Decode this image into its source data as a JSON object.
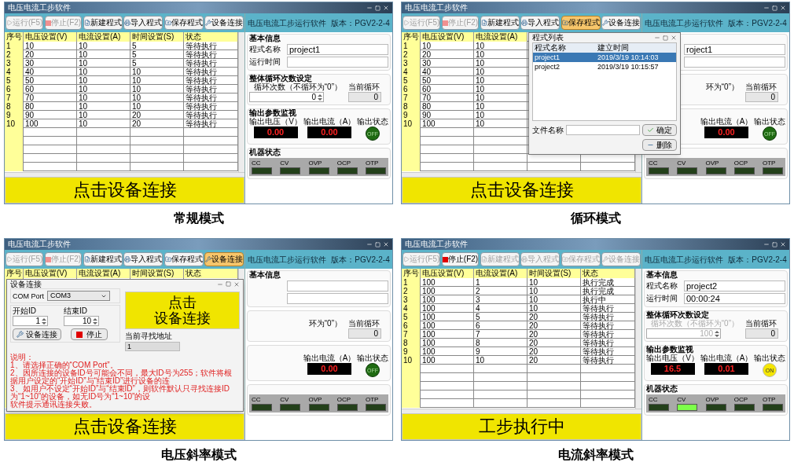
{
  "screens": [
    {
      "title": "电压电流工步软件",
      "caption": "常规模式",
      "toolbar": [
        {
          "kind": "run",
          "label": "运行(F5)",
          "disabled": true,
          "highlighted": false
        },
        {
          "kind": "stop",
          "label": "停止(F2)",
          "disabled": true,
          "highlighted": false
        },
        {
          "kind": "new",
          "label": "新建程式",
          "disabled": false,
          "highlighted": false
        },
        {
          "kind": "import",
          "label": "导入程式",
          "disabled": false,
          "highlighted": false
        },
        {
          "kind": "save",
          "label": "保存程式",
          "disabled": false,
          "highlighted": false
        },
        {
          "kind": "connect",
          "label": "设备连接",
          "disabled": false,
          "highlighted": false
        }
      ],
      "columns": [
        "序号",
        "电压设置(V)",
        "电流设置(A)",
        "时间设置(S)",
        "状态"
      ],
      "rows": [
        [
          "1",
          "10",
          "10",
          "5",
          "等待执行"
        ],
        [
          "2",
          "20",
          "10",
          "5",
          "等待执行"
        ],
        [
          "3",
          "30",
          "10",
          "5",
          "等待执行"
        ],
        [
          "4",
          "40",
          "10",
          "10",
          "等待执行"
        ],
        [
          "5",
          "50",
          "10",
          "10",
          "等待执行"
        ],
        [
          "6",
          "60",
          "10",
          "10",
          "等待执行"
        ],
        [
          "7",
          "70",
          "10",
          "10",
          "等待执行"
        ],
        [
          "8",
          "80",
          "10",
          "10",
          "等待执行"
        ],
        [
          "9",
          "90",
          "10",
          "20",
          "等待执行"
        ],
        [
          "10",
          "100",
          "10",
          "20",
          "等待执行"
        ]
      ],
      "banner": "点击设备连接",
      "panel": {
        "header": "电压电流工步运行软件",
        "version": "版本：PGV2-2-4",
        "basic": {
          "title": "基本信息",
          "name_label": "程式名称",
          "name": "project1",
          "time_label": "运行时间"
        },
        "loop": {
          "title": "整体循环次数设定",
          "count_label": "循环次数（不循环为“0”）",
          "count": "0",
          "disabled": false,
          "current_label": "当前循环",
          "current": "0"
        },
        "output": {
          "title": "输出参数监视",
          "voltage_label": "输出电压（V）",
          "voltage": "0.00",
          "current_label": "输出电流（A）",
          "current": "0.00",
          "state_label": "输出状态",
          "state": "OFF",
          "on": false
        },
        "machine": {
          "title": "机器状态",
          "leds": [
            {
              "label": "CC",
              "on": false
            },
            {
              "label": "CV",
              "on": false
            },
            {
              "label": "OVP",
              "on": false
            },
            {
              "label": "OCP",
              "on": false
            },
            {
              "label": "OTP",
              "on": false
            }
          ]
        }
      }
    },
    {
      "title": "电压电流工步软件",
      "caption": "循环模式",
      "toolbar": [
        {
          "kind": "run",
          "label": "运行(F5)",
          "disabled": true,
          "highlighted": false
        },
        {
          "kind": "stop",
          "label": "停止(F2)",
          "disabled": true,
          "highlighted": false
        },
        {
          "kind": "new",
          "label": "新建程式",
          "disabled": false,
          "highlighted": false
        },
        {
          "kind": "import",
          "label": "导入程式",
          "disabled": false,
          "highlighted": false
        },
        {
          "kind": "save",
          "label": "保存程式",
          "disabled": false,
          "highlighted": true
        },
        {
          "kind": "connect",
          "label": "设备连接",
          "disabled": false,
          "highlighted": false
        }
      ],
      "columns": [
        "序号",
        "电压设置(V)",
        "电流设置(A)"
      ],
      "rows": [
        [
          "1",
          "10",
          "10"
        ],
        [
          "2",
          "20",
          "10"
        ],
        [
          "3",
          "30",
          "10"
        ],
        [
          "4",
          "40",
          "10"
        ],
        [
          "5",
          "50",
          "10"
        ],
        [
          "6",
          "60",
          "10"
        ],
        [
          "7",
          "70",
          "10"
        ],
        [
          "8",
          "80",
          "10"
        ],
        [
          "9",
          "90",
          "10"
        ],
        [
          "10",
          "100",
          "10"
        ]
      ],
      "banner": "点击设备连接",
      "panel": {
        "header": "电压电流工步运行软件",
        "version": "版本：PGV2-2-4",
        "basic": {
          "name": "roject1"
        },
        "loop": {
          "count_label": "环为“0”）",
          "disabled": false,
          "current_label": "当前循环",
          "current": "0"
        },
        "output": {
          "current_label": "输出电流（A）",
          "current": "0.00",
          "state_label": "输出状态",
          "state": "OFF",
          "on": false
        },
        "machine": {
          "leds": [
            {
              "label": "CC",
              "on": false
            },
            {
              "label": "CV",
              "on": false
            },
            {
              "label": "OVP",
              "on": false
            },
            {
              "label": "OCP",
              "on": false
            },
            {
              "label": "OTP",
              "on": false
            }
          ]
        }
      },
      "dialog": {
        "kind": "program_list",
        "title": "程式列表",
        "columns": [
          "程式名称",
          "建立时间"
        ],
        "items": [
          {
            "name": "project1",
            "time": "2019/3/19 10:14:03",
            "selected": true
          },
          {
            "name": "project2",
            "time": "2019/3/19 10:15:57",
            "selected": false
          }
        ],
        "file_label": "文件名称",
        "ok": "确定",
        "delete": "删除"
      }
    },
    {
      "title": "电压电流工步软件",
      "caption": "电压斜率模式",
      "toolbar": [
        {
          "kind": "run",
          "label": "运行(F5)",
          "disabled": true,
          "highlighted": false
        },
        {
          "kind": "stop",
          "label": "停止(F2)",
          "disabled": true,
          "highlighted": false
        },
        {
          "kind": "new",
          "label": "新建程式",
          "disabled": false,
          "highlighted": false
        },
        {
          "kind": "import",
          "label": "导入程式",
          "disabled": false,
          "highlighted": false
        },
        {
          "kind": "save",
          "label": "保存程式",
          "disabled": false,
          "highlighted": false
        },
        {
          "kind": "connect",
          "label": "设备连接",
          "disabled": false,
          "highlighted": true
        }
      ],
      "columns": [
        "序号",
        "电压设置(V)",
        "电流设置(A)",
        "时间设置(S)",
        "状态"
      ],
      "banner": "点击设备连接",
      "panel": {
        "header": "电压电流工步运行软件",
        "version": "版本：PGV2-2-4",
        "basic": {
          "title": "基本信息"
        },
        "loop": {
          "count_label": "环为“0”）",
          "disabled": false,
          "current_label": "当前循环",
          "current": "0"
        },
        "output": {
          "current_label": "输出电流（A）",
          "current": "0.00",
          "state_label": "输出状态",
          "state": "OFF",
          "on": false
        },
        "machine": {
          "leds": [
            {
              "label": "CC",
              "on": false
            },
            {
              "label": "CV",
              "on": false
            },
            {
              "label": "OVP",
              "on": false
            },
            {
              "label": "OCP",
              "on": false
            },
            {
              "label": "OTP",
              "on": false
            }
          ]
        }
      },
      "dialog": {
        "kind": "connection",
        "title": "设备连接",
        "port_label": "COM Port",
        "port": "COM3",
        "start_label": "开始ID",
        "start": "1",
        "end_label": "结束ID",
        "end": "10",
        "connect": "设备连接",
        "stop": "停止",
        "prompt_lines": [
          "点击",
          "设备连接"
        ],
        "address_label": "当前寻找地址",
        "address": "1",
        "notes_title": "说明：",
        "notes": [
          "1、请选择正确的“COM Port”。",
          "2、因所连接的设备ID号可能会不同，最大ID号为255；软件将根据用户设定的“开始ID”与“结束ID”进行设备的连",
          "3、如用户不设定“开始ID”与“结束ID”，则软件默认只寻找连接ID为“1~10”的设备，如无ID号为“1~10”的设",
          "软件提示通讯连接失败。"
        ]
      }
    },
    {
      "title": "电压电流工步软件",
      "caption": "电流斜率模式",
      "toolbar": [
        {
          "kind": "run",
          "label": "运行(F5)",
          "disabled": true,
          "highlighted": false
        },
        {
          "kind": "stop",
          "label": "停止(F2)",
          "disabled": false,
          "highlighted": false
        },
        {
          "kind": "new",
          "label": "新建程式",
          "disabled": true,
          "highlighted": false
        },
        {
          "kind": "import",
          "label": "导入程式",
          "disabled": true,
          "highlighted": false
        },
        {
          "kind": "save",
          "label": "保存程式",
          "disabled": true,
          "highlighted": false
        },
        {
          "kind": "connect",
          "label": "设备连接",
          "disabled": true,
          "highlighted": false
        }
      ],
      "columns": [
        "序号",
        "电压设置(V)",
        "电流设置(A)",
        "时间设置(S)",
        "状态"
      ],
      "rows": [
        [
          "1",
          "100",
          "1",
          "10",
          "执行完成"
        ],
        [
          "2",
          "100",
          "2",
          "10",
          "执行完成"
        ],
        [
          "3",
          "100",
          "3",
          "10",
          "执行中"
        ],
        [
          "4",
          "100",
          "4",
          "10",
          "等待执行"
        ],
        [
          "5",
          "100",
          "5",
          "20",
          "等待执行"
        ],
        [
          "6",
          "100",
          "6",
          "20",
          "等待执行"
        ],
        [
          "7",
          "100",
          "7",
          "20",
          "等待执行"
        ],
        [
          "8",
          "100",
          "8",
          "20",
          "等待执行"
        ],
        [
          "9",
          "100",
          "9",
          "20",
          "等待执行"
        ],
        [
          "10",
          "100",
          "10",
          "20",
          "等待执行"
        ]
      ],
      "banner": "工步执行中",
      "panel": {
        "header": "电压电流工步运行软件",
        "version": "版本：PGV2-2-4",
        "basic": {
          "title": "基本信息",
          "name_label": "程式名称",
          "name": "project2",
          "time_label": "运行时间",
          "time": "00:00:24"
        },
        "loop": {
          "title": "整体循环次数设定",
          "count_label": "循环次数（不循环为“0”）",
          "count": "100",
          "disabled": true,
          "current_label": "当前循环",
          "current": "0"
        },
        "output": {
          "title": "输出参数监视",
          "voltage_label": "输出电压（V）",
          "voltage": "16.5",
          "current_label": "输出电流（A）",
          "current": "0.01",
          "state_label": "输出状态",
          "state": "ON",
          "on": true
        },
        "machine": {
          "title": "机器状态",
          "leds": [
            {
              "label": "CC",
              "on": false
            },
            {
              "label": "CV",
              "on": true
            },
            {
              "label": "OVP",
              "on": false
            },
            {
              "label": "OCP",
              "on": false
            },
            {
              "label": "OTP",
              "on": false
            }
          ]
        }
      }
    }
  ]
}
